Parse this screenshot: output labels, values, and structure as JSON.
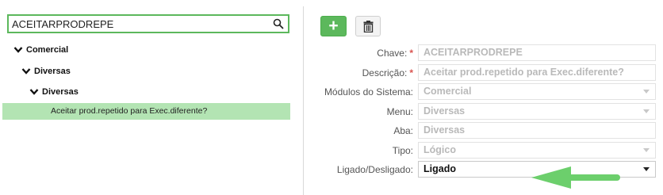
{
  "search": {
    "value": "ACEITARPRODREPE",
    "icon": "search-icon"
  },
  "tree": {
    "level1": "Comercial",
    "level2": "Diversas",
    "level3": "Diversas",
    "leaf": "Aceitar prod.repetido para Exec.diferente?"
  },
  "toolbar": {
    "add_label": "+",
    "delete_icon": "trash-icon"
  },
  "form": {
    "chave": {
      "label": "Chave:",
      "required": "*",
      "value": "ACEITARPRODREPE"
    },
    "descricao": {
      "label": "Descrição:",
      "required": "*",
      "value": "Aceitar prod.repetido para Exec.diferente?"
    },
    "modulos": {
      "label": "Módulos do Sistema:",
      "value": "Comercial"
    },
    "menu": {
      "label": "Menu:",
      "value": "Diversas"
    },
    "aba": {
      "label": "Aba:",
      "value": "Diversas"
    },
    "tipo": {
      "label": "Tipo:",
      "value": "Lógico"
    },
    "ligado": {
      "label": "Ligado/Desligado:",
      "value": "Ligado"
    }
  },
  "colors": {
    "accent": "#5cb85c",
    "selected_row": "#b3e4b3",
    "required": "#d9534f"
  }
}
